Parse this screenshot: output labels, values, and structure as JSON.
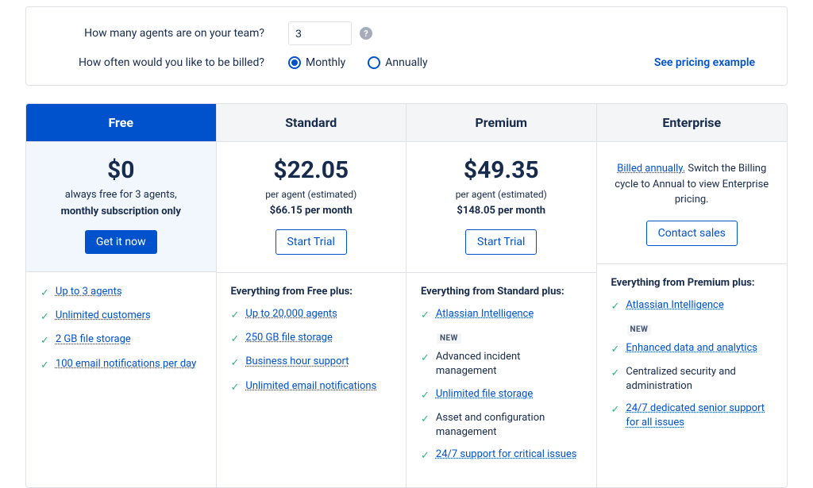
{
  "config": {
    "agents_label": "How many agents are on your team?",
    "agents_value": "3",
    "billing_label": "How often would you like to be billed?",
    "option_monthly": "Monthly",
    "option_annually": "Annually",
    "pricing_link": "See pricing example"
  },
  "plans": {
    "free": {
      "name": "Free",
      "price": "$0",
      "sub1": "always free for 3 agents,",
      "sub2": "monthly subscription only",
      "cta": "Get it now",
      "features": [
        "Up to 3 agents",
        "Unlimited customers",
        "2 GB file storage",
        "100 email notifications per day"
      ]
    },
    "standard": {
      "name": "Standard",
      "price": "$22.05",
      "sub1": "per agent (estimated)",
      "sub2": "$66.15 per month",
      "cta": "Start Trial",
      "features_title": "Everything from Free plus:",
      "features": [
        "Up to 20,000 agents",
        "250 GB file storage",
        "Business hour support",
        "Unlimited email notifications"
      ]
    },
    "premium": {
      "name": "Premium",
      "price": "$49.35",
      "sub1": "per agent (estimated)",
      "sub2": "$148.05 per month",
      "cta": "Start Trial",
      "features_title": "Everything from Standard plus:",
      "new_label": "NEW",
      "feat0": "Atlassian Intelligence",
      "feat1": "Advanced incident management",
      "feat2": "Unlimited file storage",
      "feat3": "Asset and configuration management",
      "feat4": "24/7 support for critical issues"
    },
    "enterprise": {
      "name": "Enterprise",
      "billed_link": "Billed annually.",
      "billed_text": " Switch the Billing cycle to Annual to view Enterprise pricing.",
      "cta": "Contact sales",
      "features_title": "Everything from Premium plus:",
      "new_label": "NEW",
      "feat0": "Atlassian Intelligence",
      "feat1": "Enhanced data and analytics",
      "feat2": "Centralized security and administration",
      "feat3": "24/7 dedicated senior support for all issues"
    }
  }
}
